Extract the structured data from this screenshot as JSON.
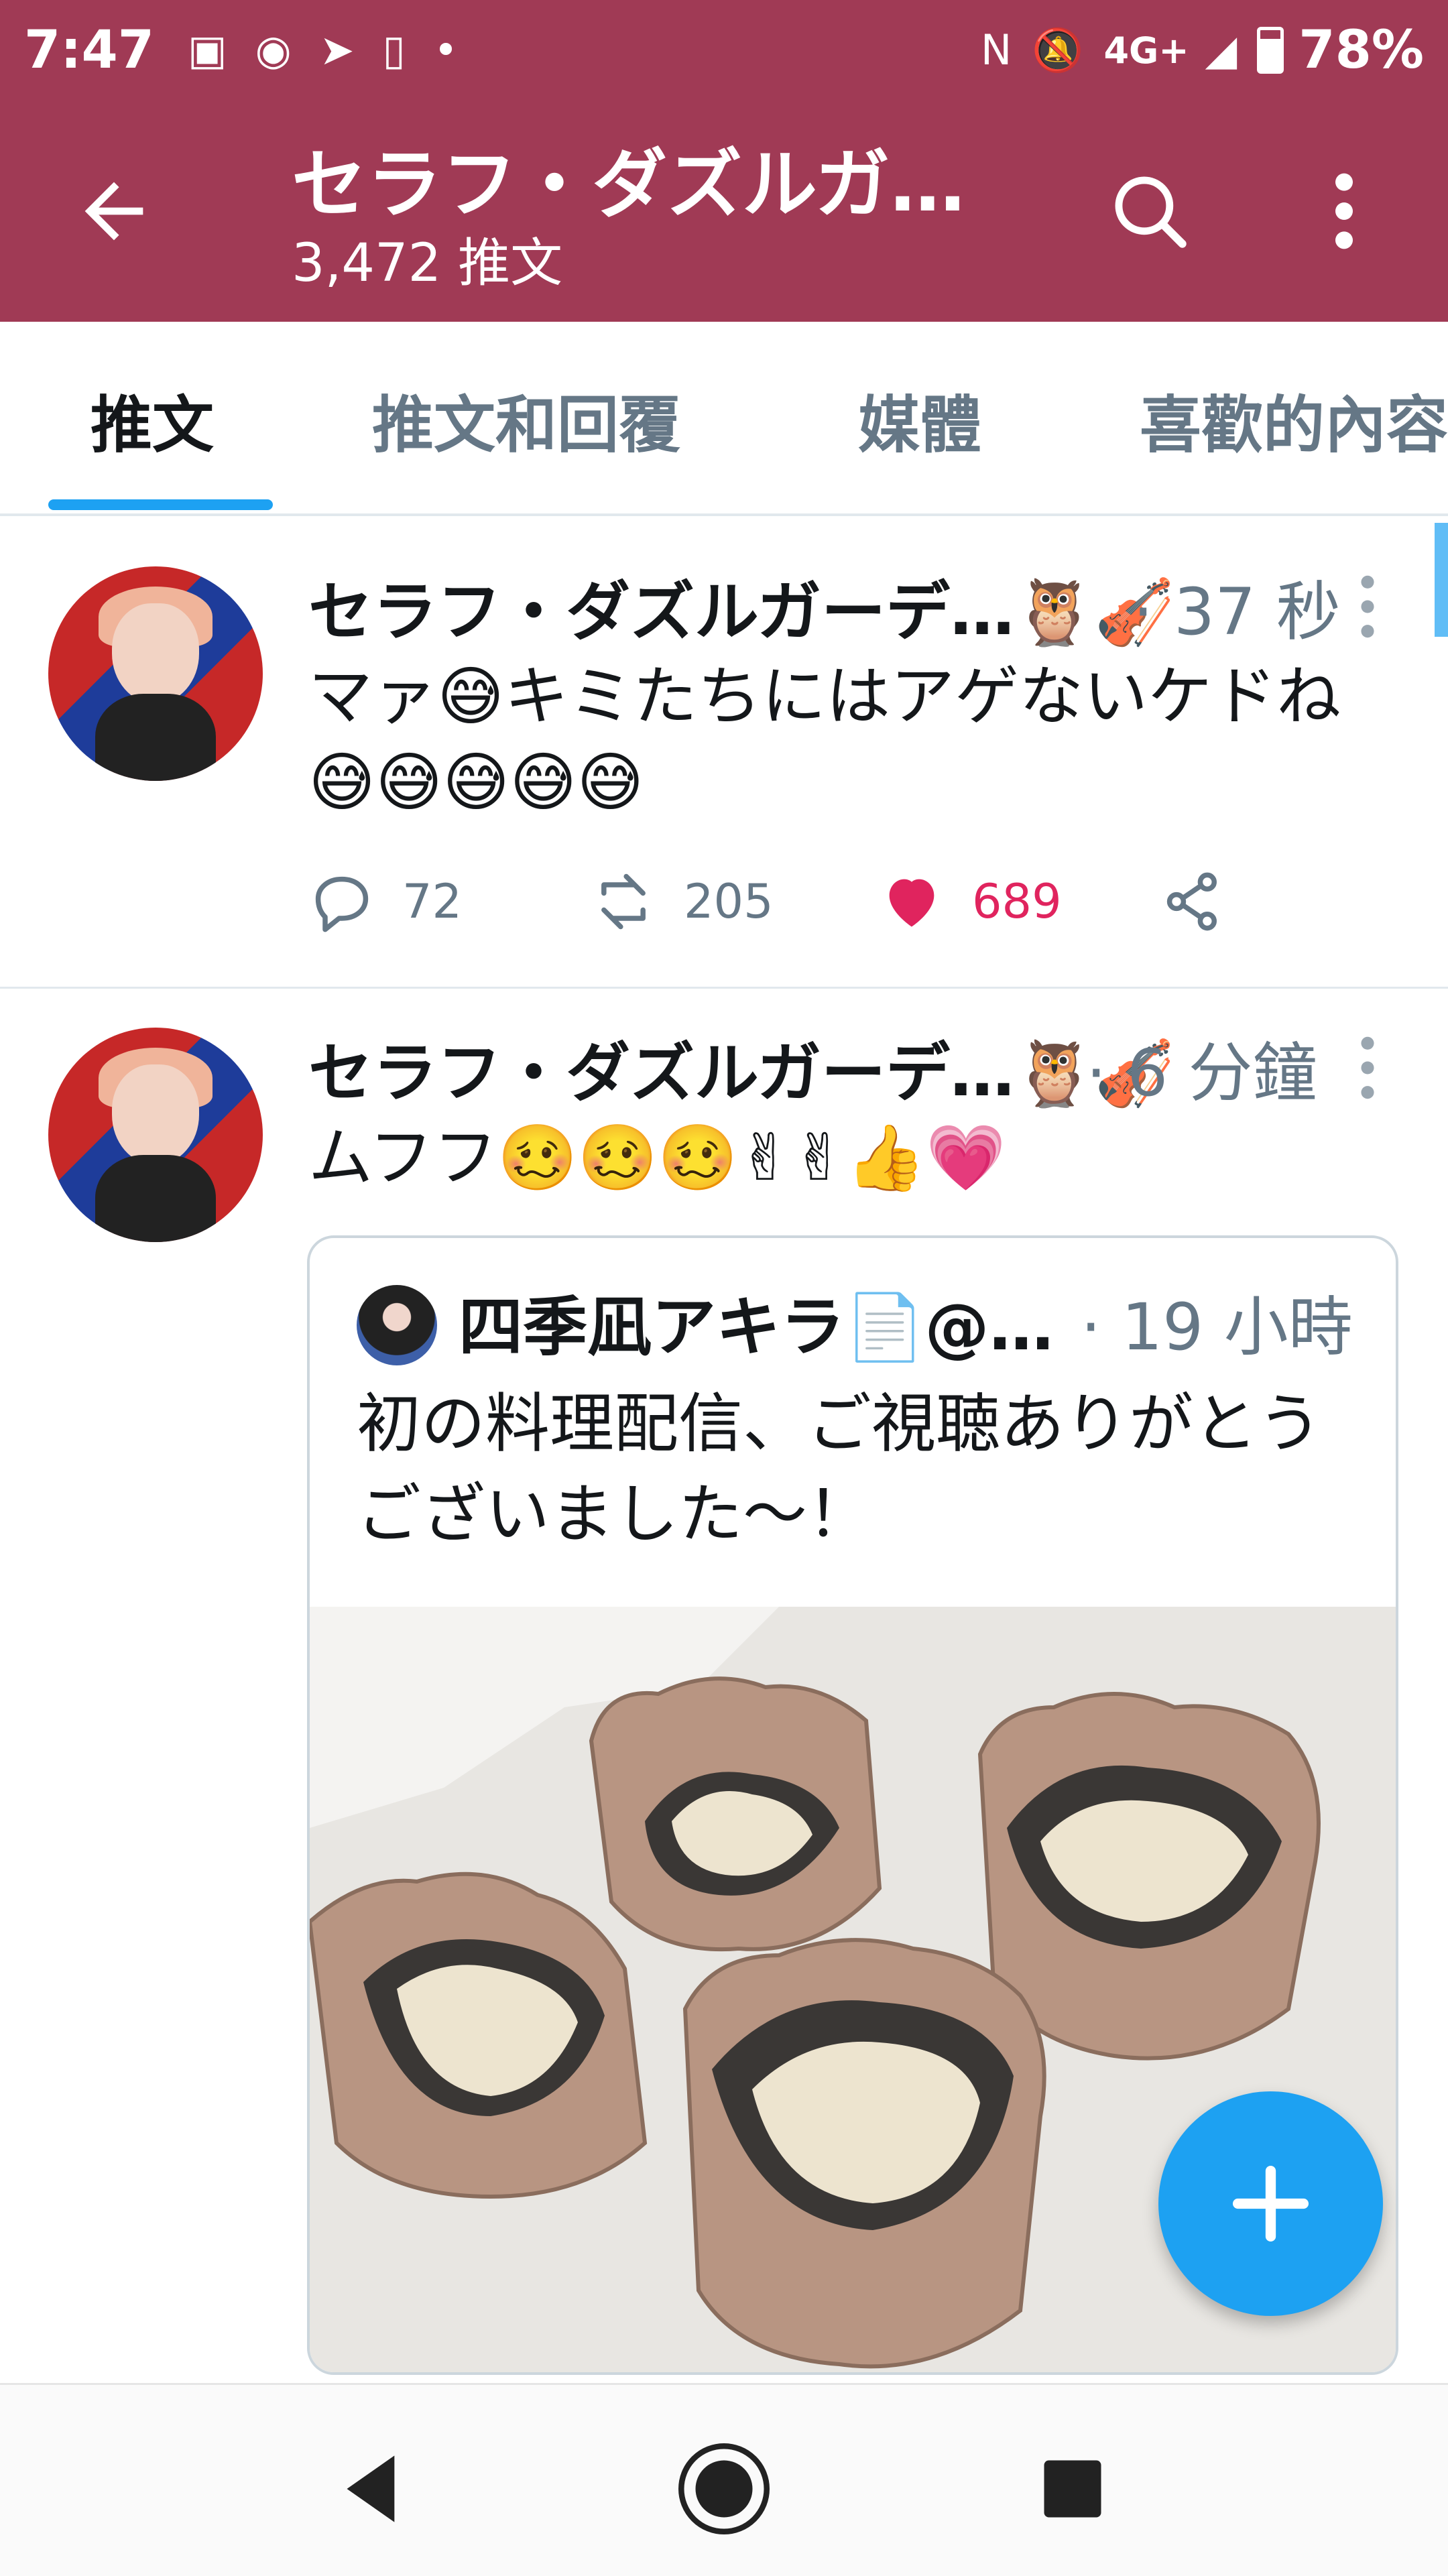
{
  "status_bar": {
    "time": "7:47",
    "network": "4G+",
    "battery": "78%",
    "battery_level": 0.78,
    "icons": [
      "image-icon",
      "line-app-icon",
      "paper-plane-icon",
      "phone-transfer-icon",
      "dot-icon",
      "nfc-icon",
      "mute-icon",
      "signal-icon",
      "battery-icon"
    ]
  },
  "app_bar": {
    "title": "セラフ・ダズルガ…",
    "subtitle": "3,472 推文",
    "background": "#a03a55"
  },
  "tabs": [
    {
      "label": "推文",
      "active": true
    },
    {
      "label": "推文和回覆",
      "active": false
    },
    {
      "label": "媒體",
      "active": false
    },
    {
      "label": "喜歡的內容",
      "active": false
    }
  ],
  "tweets": [
    {
      "author": "セラフ・ダズルガーデ…🦉🎻",
      "time": "· 37 秒",
      "text": "マァ😅キミたちにはアゲないケドね😅😅😅😅😅",
      "replies": "72",
      "retweets": "205",
      "likes": "689",
      "liked": true
    },
    {
      "author": "セラフ・ダズルガーデ…🦉🎻",
      "time": "· 6 分鐘",
      "text": "ムフフ🥴🥴🥴✌✌👍💗",
      "quote": {
        "author": "四季凪アキラ📄@…",
        "time": "· 19 小時",
        "text": "初の料理配信、ご視聴ありがとうございました〜！"
      }
    }
  ],
  "colors": {
    "accent": "#1da1f2",
    "like": "#e0245e",
    "muted": "#657786"
  }
}
